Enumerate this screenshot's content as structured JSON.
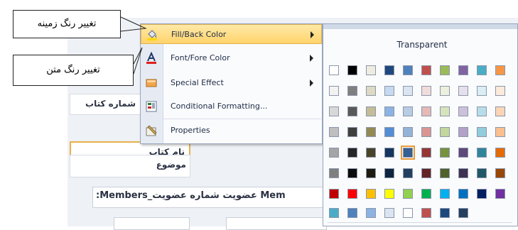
{
  "form": {
    "number_label": "شماره کتاب",
    "title_label": "نام کتاب",
    "subject_label": "موضوع",
    "member_text": ":Members_عضویت شماره عضویت Mem"
  },
  "context_menu": {
    "items": [
      {
        "label": "Fill/Back Color",
        "icon": "fill-bucket-icon",
        "has_submenu": true
      },
      {
        "label": "Font/Fore Color",
        "icon": "font-color-icon",
        "has_submenu": true
      },
      {
        "label": "Special Effect",
        "icon": "special-effect-icon",
        "has_submenu": true
      },
      {
        "label": "Conditional Formatting...",
        "icon": "conditional-formatting-icon",
        "has_submenu": false
      },
      {
        "label": "Properties",
        "icon": "properties-icon",
        "has_submenu": false
      }
    ]
  },
  "palette": {
    "transparent_label": "Transparent",
    "rows": [
      [
        "#ffffff",
        "#000000",
        "#eeece1",
        "#1f497d",
        "#4f81bd",
        "#c0504d",
        "#9bbb59",
        "#8064a2",
        "#4bacc6",
        "#f79646"
      ],
      [
        "#f2f2f2",
        "#7f7f7f",
        "#ddd9c3",
        "#c6d9f0",
        "#dbe5f1",
        "#f2dcdb",
        "#ebf1dd",
        "#e5e0ec",
        "#dbeef3",
        "#fdeada"
      ],
      [
        "#d8d8d8",
        "#595959",
        "#c4bd97",
        "#8db3e2",
        "#b8cce4",
        "#e5b9b7",
        "#d7e3bc",
        "#ccc1d9",
        "#b7dde8",
        "#fbd5b5"
      ],
      [
        "#bfbfbf",
        "#3f3f3f",
        "#938953",
        "#548dd4",
        "#95b3d7",
        "#d99694",
        "#c3d69b",
        "#b2a2c7",
        "#92cddc",
        "#fac08f"
      ],
      [
        "#a5a5a5",
        "#262626",
        "#494429",
        "#17365d",
        "#366092",
        "#953734",
        "#76923c",
        "#5f497a",
        "#31859b",
        "#e36c09"
      ],
      [
        "#7f7f7f",
        "#0c0c0c",
        "#1d1b10",
        "#0f243e",
        "#244061",
        "#632423",
        "#4f6128",
        "#3f3151",
        "#205867",
        "#974806"
      ],
      [
        "#c00000",
        "#ff0000",
        "#ffc000",
        "#ffff00",
        "#92d050",
        "#00b050",
        "#00b0f0",
        "#0070c0",
        "#002060",
        "#7030a0"
      ]
    ],
    "recent": [
      "#4bacc6",
      "#4f81bd",
      "#8db3e2",
      "#dbe5f1",
      "#ffffff",
      "#c0504d",
      "#1f497d",
      "#244061"
    ],
    "selected": {
      "row": 4,
      "col": 4
    }
  },
  "callouts": {
    "fill_label": "تغییر رنگ زمینه",
    "font_label": "تغییر رنگ متن"
  }
}
